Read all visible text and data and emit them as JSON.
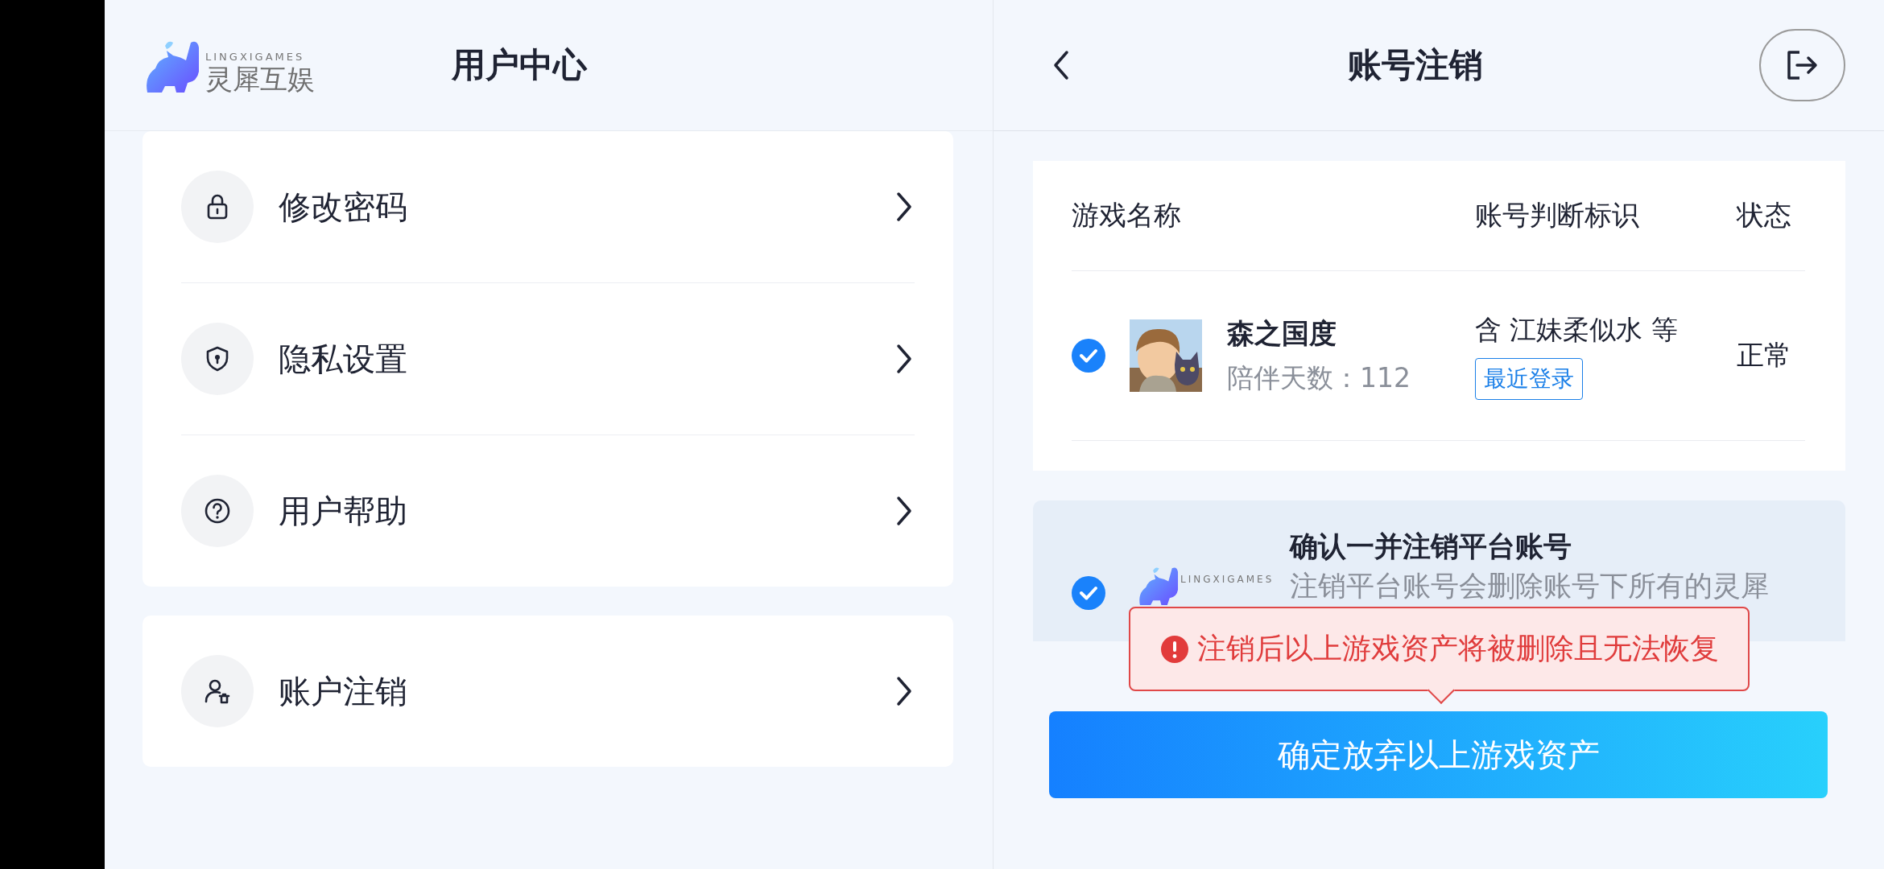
{
  "sidebar": {
    "logo": {
      "latin": "LINGXIGAMES",
      "name": "灵犀互娱"
    },
    "title": "用户中心",
    "groups": [
      {
        "items": [
          {
            "label": "修改密码",
            "kind": "lock"
          },
          {
            "label": "隐私设置",
            "kind": "shield"
          },
          {
            "label": "用户帮助",
            "kind": "help"
          }
        ]
      },
      {
        "items": [
          {
            "label": "账户注销",
            "kind": "account-remove"
          }
        ]
      }
    ]
  },
  "panel": {
    "title": "账号注销",
    "table": {
      "columns": [
        "游戏名称",
        "账号判断标识",
        "状态"
      ],
      "rows": [
        {
          "checked": true,
          "game": "森之国度",
          "days": "陪伴天数：112",
          "roles": "含 江妹柔似水 等",
          "tag": "最近登录",
          "status": "正常"
        }
      ]
    },
    "platform": {
      "checked": true,
      "logo_latin": "LINGXIGAMES",
      "title": "确认一并注销平台账号",
      "description": "注销平台账号会删除账号下所有的灵犀"
    },
    "warning": "注销后以上游戏资产将被删除且无法恢复",
    "confirm_button": "确定放弃以上游戏资产"
  }
}
